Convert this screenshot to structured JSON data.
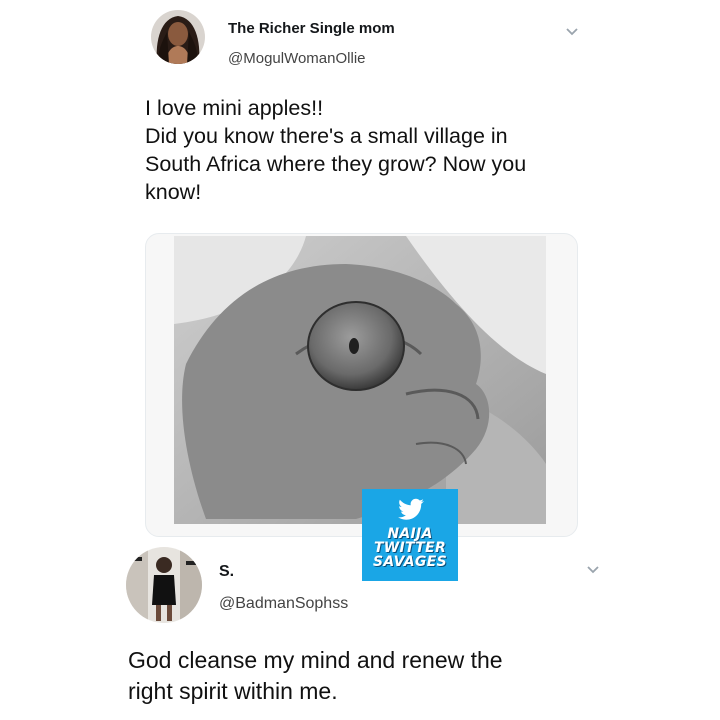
{
  "tweet": {
    "display_name": "The Richer Single mom",
    "handle": "@MogulWomanOllie",
    "text_lines": [
      "I love mini apples!!",
      "Did you know there's a small village in",
      "South Africa where they grow? Now you",
      "know!"
    ],
    "avatar_icon": "profile-photo",
    "menu_icon": "chevron-down-icon"
  },
  "watermark": {
    "lines": [
      "NAIJA",
      "TWITTER",
      "SAVAGES"
    ],
    "icon": "twitter-bird-icon",
    "color": "#1aa6e6"
  },
  "reply": {
    "display_name": "S.",
    "handle": "@BadmanSophss",
    "text_lines": [
      "God cleanse my mind and renew the",
      "right spirit within me."
    ],
    "avatar_icon": "profile-photo",
    "menu_icon": "chevron-down-icon"
  }
}
